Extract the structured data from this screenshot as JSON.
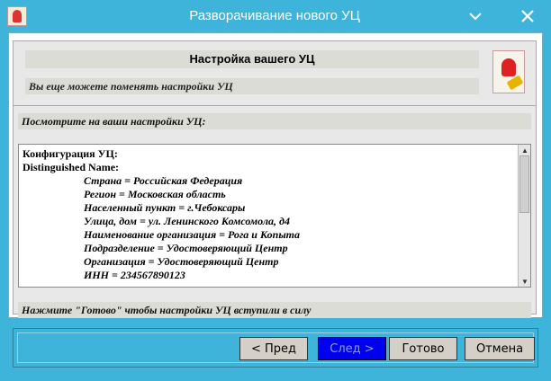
{
  "window": {
    "title": "Разворачивание нового УЦ"
  },
  "header": {
    "title": "Настройка вашего УЦ",
    "subtitle": "Вы еще можете поменять настройки УЦ"
  },
  "main": {
    "review_label": "Посмотрите на ваши настройки УЦ:",
    "config_lines": [
      "Конфигурация УЦ:",
      "Distinguished Name:",
      "Страна = Российская Федерация",
      "Регион = Московская область",
      "Населенный пункт = г.Чебоксары",
      "Улица, дом = ул. Ленинского Комсомола, д4",
      "Наименование организация = Рога и Копыта",
      "Подразделение = Удостоверяющий Центр",
      "Организация = Удостоверяющий Центр",
      "ИНН = 234567890123"
    ],
    "footer_note": "Нажмите \"Готово\" чтобы настройки УЦ вступили в силу"
  },
  "buttons": {
    "prev": "< Пред",
    "next": "След >",
    "done": "Готово",
    "cancel": "Отмена"
  },
  "colors": {
    "titlebar": "#3fb4da",
    "next_button": "#0000ee"
  }
}
